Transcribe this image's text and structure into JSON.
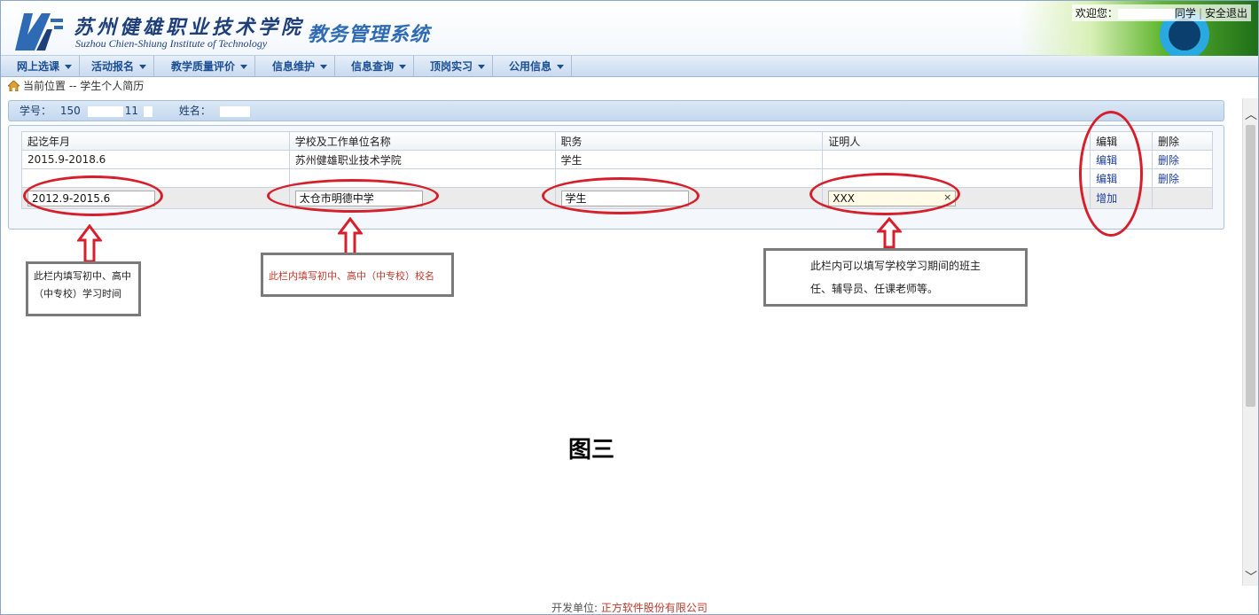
{
  "header": {
    "school_cn": "苏州健雄职业技术学院",
    "school_en": "Suzhou Chien-Shiung Institute of Technology",
    "system_title": "教务管理系统",
    "welcome": "欢迎您：",
    "user_suffix": "同学",
    "logout": "安全退出"
  },
  "nav": {
    "items": [
      {
        "label": "网上选课"
      },
      {
        "label": "活动报名"
      },
      {
        "label": "教学质量评价"
      },
      {
        "label": "信息维护"
      },
      {
        "label": "信息查询"
      },
      {
        "label": "顶岗实习"
      },
      {
        "label": "公用信息"
      }
    ]
  },
  "breadcrumb": {
    "text": "当前位置 -- 学生个人简历"
  },
  "info_bar": {
    "student_id_label": "学号：",
    "student_id_visible_start": "150",
    "student_id_visible_end": "11",
    "name_label": "姓名："
  },
  "table": {
    "headers": [
      "起讫年月",
      "学校及工作单位名称",
      "职务",
      "证明人",
      "编辑",
      "删除"
    ],
    "rows": [
      {
        "period": "2015.9-2018.6",
        "school": "苏州健雄职业技术学院",
        "position": "学生",
        "witness": "",
        "edit": "编辑",
        "delete": "删除"
      },
      {
        "period": "",
        "school": "",
        "position": "",
        "witness": "",
        "edit": "编辑",
        "delete": "删除"
      }
    ],
    "input_row": {
      "period": "2012.9-2015.6",
      "school": "太仓市明德中学",
      "position": "学生",
      "witness": "XXX",
      "add": "增加",
      "clear_symbol": "×"
    }
  },
  "annotations": {
    "note1": "此栏内填写初中、高中（中专校）学习时间",
    "note2": "此栏内填写初中、高中（中专校）校名",
    "note3": "此栏内可以填写学校学习期间的班主任、辅导员、任课老师等。",
    "figure_label": "图三",
    "color_ellipse": "#d61f2a"
  },
  "footer": {
    "label": "开发单位:",
    "company": "正方软件股份有限公司"
  }
}
